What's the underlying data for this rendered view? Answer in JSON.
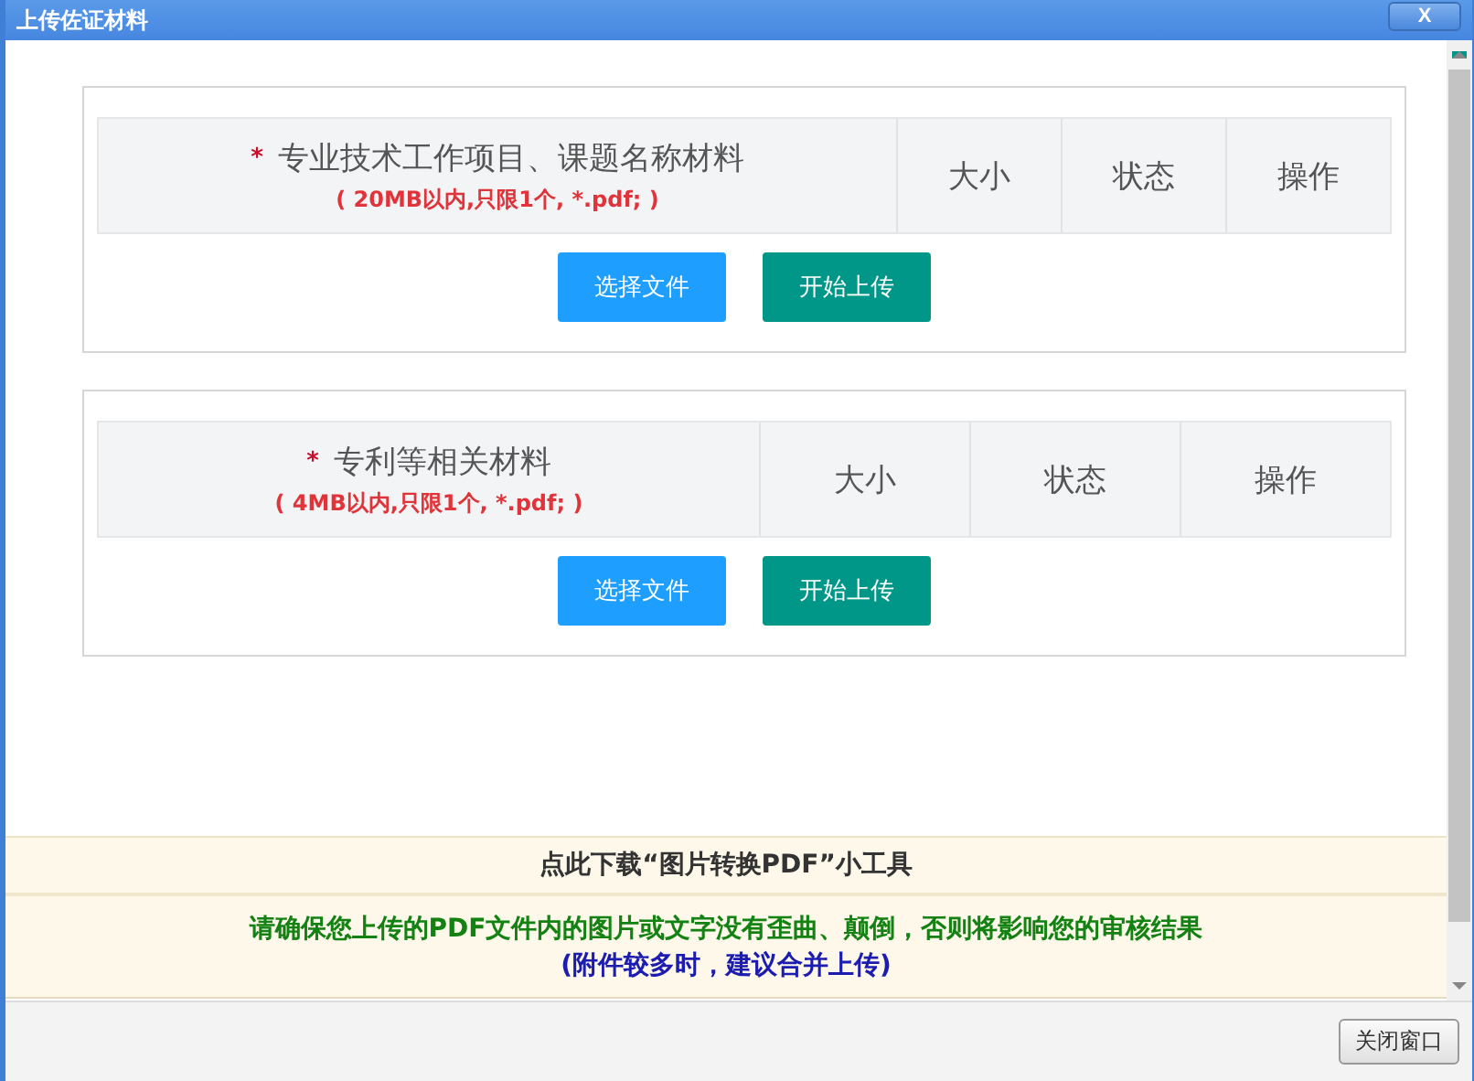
{
  "window": {
    "title": "上传佐证材料",
    "close": "X"
  },
  "sections": [
    {
      "required_mark": "*",
      "title": "专业技术工作项目、课题名称材料",
      "note": "( 20MB以内,只限1个, *.pdf; )",
      "columns": [
        "大小",
        "状态",
        "操作"
      ],
      "buttons": [
        {
          "label": "选择文件",
          "kind": "select"
        },
        {
          "label": "开始上传",
          "kind": "upload"
        }
      ]
    },
    {
      "required_mark": "*",
      "title": "专利等相关材料",
      "note": "( 4MB以内,只限1个, *.pdf; )",
      "columns": [
        "大小",
        "状态",
        "操作"
      ],
      "buttons": [
        {
          "label": "选择文件",
          "kind": "select"
        },
        {
          "label": "开始上传",
          "kind": "upload"
        }
      ]
    }
  ],
  "download_link": "点此下载“图片转换PDF”小工具",
  "warning": "请确保您上传的PDF文件内的图片或文字没有歪曲、颠倒，否则将影响您的审核结果",
  "hint": "(附件较多时，建议合并上传)",
  "close_button": "关闭窗口"
}
